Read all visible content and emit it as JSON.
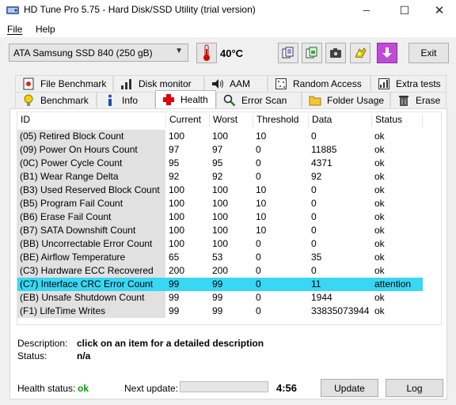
{
  "window": {
    "title": "HD Tune Pro 5.75 - Hard Disk/SSD Utility (trial version)",
    "controls": {
      "minimize": "─",
      "maximize": "☐",
      "close": "✕"
    }
  },
  "menu": {
    "file": "File",
    "help": "Help"
  },
  "toolbar": {
    "drive": "ATA    Samsung SSD 840 (250 gB)",
    "temperature": "40°C",
    "exit_label": "Exit",
    "icons": [
      "copy-info-icon",
      "copy-screenshot-icon",
      "camera-icon",
      "settings-icon",
      "download-icon"
    ]
  },
  "tabs_top": [
    {
      "label": "File Benchmark",
      "icon": "file-benchmark-icon"
    },
    {
      "label": "Disk monitor",
      "icon": "disk-monitor-icon"
    },
    {
      "label": "AAM",
      "icon": "speaker-icon"
    },
    {
      "label": "Random Access",
      "icon": "random-access-icon"
    },
    {
      "label": "Extra tests",
      "icon": "extra-tests-icon"
    }
  ],
  "tabs_bottom": [
    {
      "label": "Benchmark",
      "icon": "lightbulb-icon"
    },
    {
      "label": "Info",
      "icon": "info-icon"
    },
    {
      "label": "Health",
      "icon": "health-cross-icon",
      "active": true
    },
    {
      "label": "Error Scan",
      "icon": "magnifier-icon"
    },
    {
      "label": "Folder Usage",
      "icon": "folder-icon"
    },
    {
      "label": "Erase",
      "icon": "trash-icon"
    }
  ],
  "smart_table": {
    "columns": [
      "ID",
      "Current",
      "Worst",
      "Threshold",
      "Data",
      "Status"
    ],
    "rows": [
      [
        "(05) Retired Block Count",
        "100",
        "100",
        "10",
        "0",
        "ok"
      ],
      [
        "(09) Power On Hours Count",
        "97",
        "97",
        "0",
        "11885",
        "ok"
      ],
      [
        "(0C) Power Cycle Count",
        "95",
        "95",
        "0",
        "4371",
        "ok"
      ],
      [
        "(B1) Wear Range Delta",
        "92",
        "92",
        "0",
        "92",
        "ok"
      ],
      [
        "(B3) Used Reserved Block Count",
        "100",
        "100",
        "10",
        "0",
        "ok"
      ],
      [
        "(B5) Program Fail Count",
        "100",
        "100",
        "10",
        "0",
        "ok"
      ],
      [
        "(B6) Erase Fail Count",
        "100",
        "100",
        "10",
        "0",
        "ok"
      ],
      [
        "(B7) SATA Downshift Count",
        "100",
        "100",
        "10",
        "0",
        "ok"
      ],
      [
        "(BB) Uncorrectable Error Count",
        "100",
        "100",
        "0",
        "0",
        "ok"
      ],
      [
        "(BE) Airflow Temperature",
        "65",
        "53",
        "0",
        "35",
        "ok"
      ],
      [
        "(C3) Hardware ECC Recovered",
        "200",
        "200",
        "0",
        "0",
        "ok"
      ],
      [
        "(C7) Interface CRC Error Count",
        "99",
        "99",
        "0",
        "11",
        "attention"
      ],
      [
        "(EB) Unsafe Shutdown Count",
        "99",
        "99",
        "0",
        "1944",
        "ok"
      ],
      [
        "(F1) LifeTime Writes",
        "99",
        "99",
        "0",
        "33835073944",
        "ok"
      ]
    ],
    "selected_row_index": 11,
    "selected_color": "#38d7f3"
  },
  "details": {
    "description_label": "Description:",
    "description_value": "click on an item for a detailed description",
    "status_label": "Status:",
    "status_value": "n/a"
  },
  "footer": {
    "health_label": "Health status:",
    "health_value": "ok",
    "health_color": "#00a000",
    "next_update_label": "Next update:",
    "next_update_progress": 0.0,
    "countdown": "4:56",
    "update_button": "Update",
    "log_button": "Log"
  }
}
